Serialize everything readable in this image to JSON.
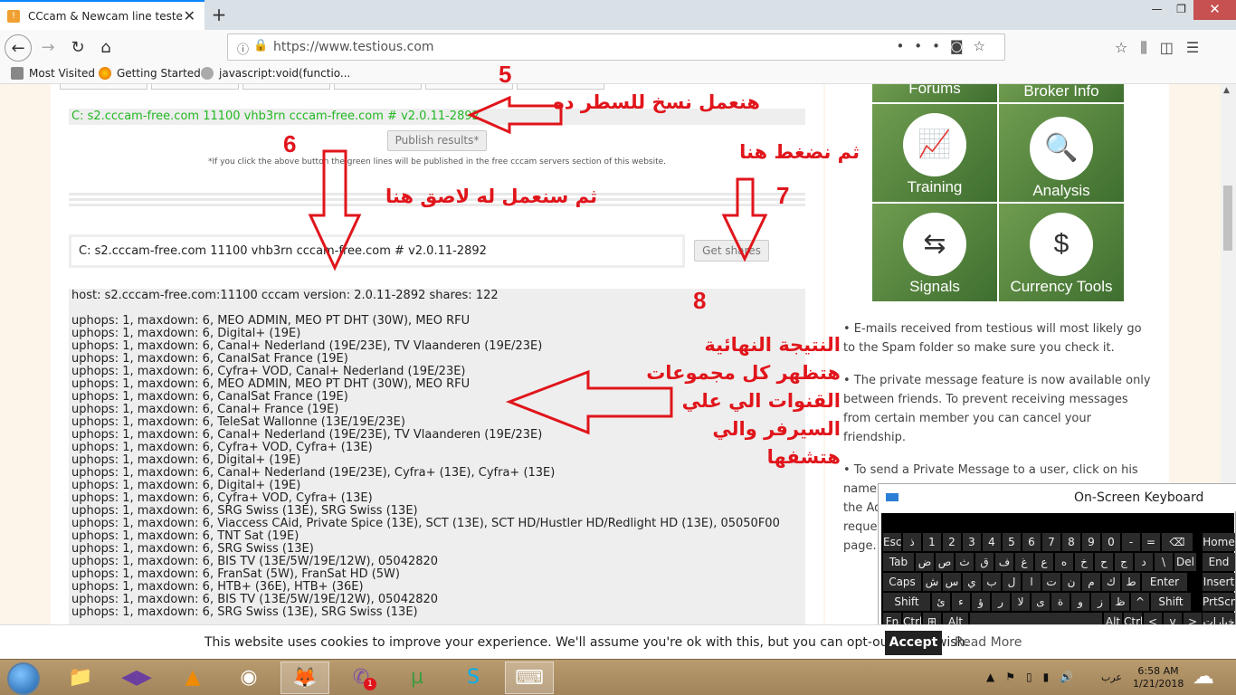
{
  "browser": {
    "tab_title": "CCcam & Newcam line tester",
    "tab_icon": "favicon-orange-icon",
    "url": "https://www.testious.com",
    "bookmarks": [
      "Most Visited",
      "Getting Started",
      "javascript:void(functio..."
    ]
  },
  "tester": {
    "test_line": "C: s2.cccam-free.com 11100 vhb3rn cccam-free.com # v2.0.11-2892",
    "publish_label": "Publish results*",
    "publish_note": "*If you click the above button the green lines will be published in the free cccam servers section of this website.",
    "input_value": "C: s2.cccam-free.com 11100 vhb3rn cccam-free.com # v2.0.11-2892",
    "get_shares_label": "Get shares",
    "host_line": "host: s2.cccam-free.com:11100 cccam version: 2.0.11-2892 shares: 122",
    "results": [
      "uphops: 1, maxdown: 6, MEO ADMIN, MEO PT DHT (30W), MEO RFU",
      "uphops: 1, maxdown: 6, Digital+ (19E)",
      "uphops: 1, maxdown: 6, Canal+ Nederland (19E/23E), TV Vlaanderen (19E/23E)",
      "uphops: 1, maxdown: 6, CanalSat France (19E)",
      "uphops: 1, maxdown: 6, Cyfra+ VOD, Canal+ Nederland (19E/23E)",
      "uphops: 1, maxdown: 6, MEO ADMIN, MEO PT DHT (30W), MEO RFU",
      "uphops: 1, maxdown: 6, CanalSat France (19E)",
      "uphops: 1, maxdown: 6, Canal+ France (19E)",
      "uphops: 1, maxdown: 6, TeleSat Wallonne (13E/19E/23E)",
      "uphops: 1, maxdown: 6, Canal+ Nederland (19E/23E), TV Vlaanderen (19E/23E)",
      "uphops: 1, maxdown: 6, Cyfra+ VOD, Cyfra+ (13E)",
      "uphops: 1, maxdown: 6, Digital+ (19E)",
      "uphops: 1, maxdown: 6, Canal+ Nederland (19E/23E), Cyfra+ (13E), Cyfra+ (13E)",
      "uphops: 1, maxdown: 6, Digital+ (19E)",
      "uphops: 1, maxdown: 6, Cyfra+ VOD, Cyfra+ (13E)",
      "uphops: 1, maxdown: 6, SRG Swiss (13E), SRG Swiss (13E)",
      "uphops: 1, maxdown: 6, Viaccess CAid, Private Spice (13E), SCT (13E), SCT HD/Hustler HD/Redlight HD (13E), 05050F00",
      "uphops: 1, maxdown: 6, TNT Sat (19E)",
      "uphops: 1, maxdown: 6, SRG Swiss (13E)",
      "uphops: 1, maxdown: 6, BIS TV (13E/5W/19E/12W), 05042820",
      "uphops: 1, maxdown: 6, FranSat (5W), FranSat HD (5W)",
      "uphops: 1, maxdown: 6, HTB+ (36E), HTB+ (36E)",
      "uphops: 1, maxdown: 6, BIS TV (13E/5W/19E/12W), 05042820",
      "uphops: 1, maxdown: 6, SRG Swiss (13E), SRG Swiss (13E)"
    ]
  },
  "annotations": {
    "step5_num": "5",
    "step5_text": "هنعمل نسخ للسطر ده",
    "step6_num": "6",
    "step6_text": "ثم سنعمل له لاصق هنا",
    "step7_num": "7",
    "step7_text": "ثم نضغط هنا",
    "step8_num": "8",
    "step8_lines": [
      "النتيجة النهائية",
      "هتظهر كل مجموعات",
      "القنوات الي علي",
      "السيرفر والي",
      "هتشفها"
    ],
    "color": "#e0151b"
  },
  "sidebar": {
    "tiles": [
      {
        "label": "Forums",
        "icon": "forums-icon"
      },
      {
        "label": "Broker Info",
        "icon": "broker-info-icon"
      },
      {
        "label": "Training",
        "icon": "presentation-board-icon"
      },
      {
        "label": "Analysis",
        "icon": "magnifier-eye-icon"
      },
      {
        "label": "Signals",
        "icon": "signpost-icon"
      },
      {
        "label": "Currency Tools",
        "icon": "currency-coins-icon"
      }
    ],
    "bullets": [
      "• E-mails received from testious will most likely go to the Spam folder so make sure you check it.",
      "• The private message feature is now available only between friends. To prevent receiving messages from certain member you can cancel your friendship.",
      "• To send a Private Message to a user, click on his name or avatar to view his profile page. Then click the Add Friend button. Once he accepts your friend request you can send private message via his profile page."
    ]
  },
  "osk": {
    "title": "On-Screen Keyboard"
  },
  "cookie": {
    "text": "This website uses cookies to improve your experience. We'll assume you're ok with this, but you can opt-out if you wish.",
    "accept": "Accept",
    "read_more": "Read More"
  },
  "taskbar": {
    "lang": "عرب",
    "time": "6:58 AM",
    "date": "1/21/2018",
    "viber_badge": "1"
  }
}
